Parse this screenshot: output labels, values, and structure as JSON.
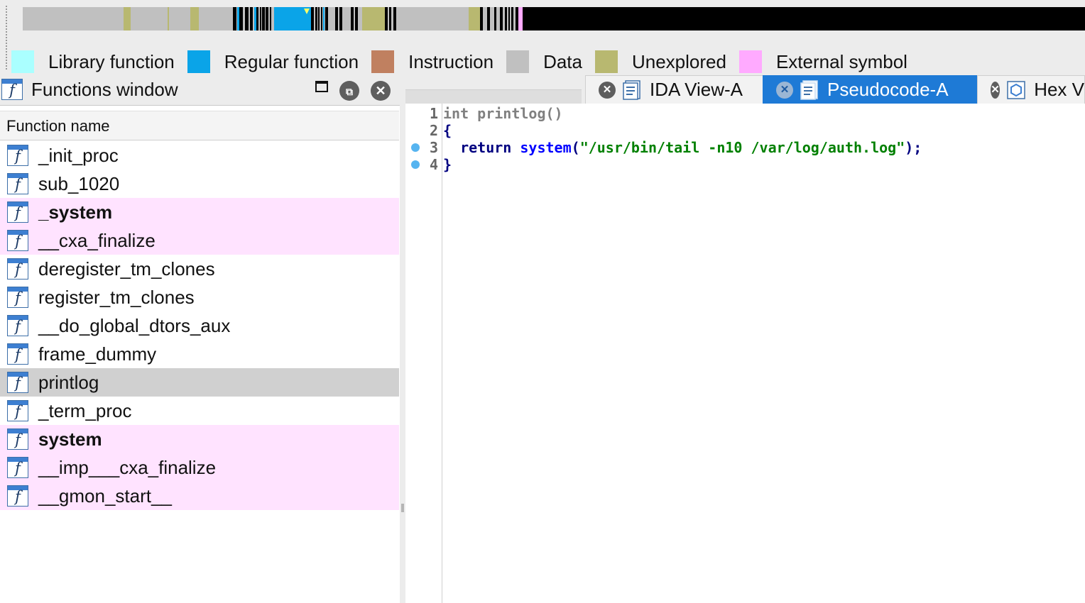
{
  "legend": {
    "library_function": "Library function",
    "regular_function": "Regular function",
    "instruction": "Instruction",
    "data": "Data",
    "unexplored": "Unexplored",
    "external_symbol": "External symbol"
  },
  "colors": {
    "library": "#aaffff",
    "regular": "#0aa4e8",
    "instruction": "#c08060",
    "data": "#c0c0c0",
    "unexplored": "#b8b870",
    "external": "#ffaaff",
    "selected_tab": "#1e7ad6",
    "external_row": "#ffe3ff"
  },
  "functions_window": {
    "title": "Functions window",
    "column_header": "Function name",
    "rows": [
      {
        "name": "_init_proc"
      },
      {
        "name": "sub_1020"
      },
      {
        "name": "_system"
      },
      {
        "name": "__cxa_finalize"
      },
      {
        "name": "deregister_tm_clones"
      },
      {
        "name": "register_tm_clones"
      },
      {
        "name": "__do_global_dtors_aux"
      },
      {
        "name": "frame_dummy"
      },
      {
        "name": "printlog"
      },
      {
        "name": "_term_proc"
      },
      {
        "name": "system"
      },
      {
        "name": "__imp___cxa_finalize"
      },
      {
        "name": "__gmon_start__"
      }
    ]
  },
  "tabs": [
    {
      "label": "IDA View-A"
    },
    {
      "label": "Pseudocode-A"
    },
    {
      "label": "Hex V"
    }
  ],
  "code": {
    "line_numbers": [
      "1",
      "2",
      "3",
      "4"
    ],
    "line1": "int printlog()",
    "line2": "{",
    "line3_kw": "return",
    "line3_fn": "system",
    "line3_open": "(",
    "line3_str": "\"/usr/bin/tail -n10 /var/log/auth.log\"",
    "line3_close": ");",
    "line4": "}"
  }
}
